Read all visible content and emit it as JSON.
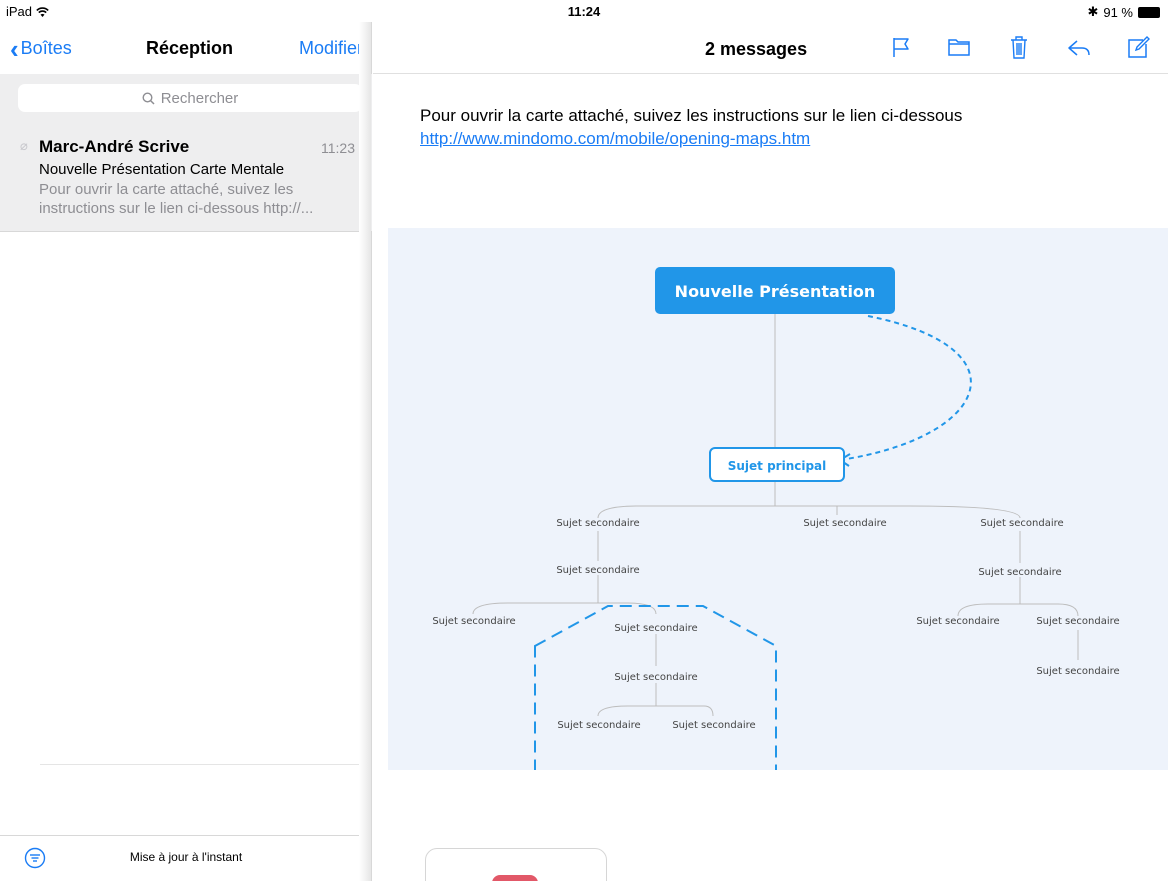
{
  "status_bar": {
    "device": "iPad",
    "time": "11:24",
    "battery": "91 %"
  },
  "left_nav": {
    "back_label": "Boîtes",
    "title": "Réception",
    "edit_label": "Modifier"
  },
  "search": {
    "placeholder": "Rechercher"
  },
  "mail_list": [
    {
      "sender": "Marc-André Scrive",
      "time": "11:23",
      "subject": "Nouvelle Présentation Carte Mentale",
      "preview_line1": "Pour ouvrir la carte attaché, suivez les",
      "preview_line2": "instructions sur le lien ci-dessous http://..."
    }
  ],
  "left_footer": {
    "status": "Mise à jour à l'instant"
  },
  "right_nav": {
    "message_count": "2 messages"
  },
  "toolbar_icons": [
    "flag-icon",
    "folder-icon",
    "trash-icon",
    "reply-icon",
    "compose-icon"
  ],
  "message": {
    "body": "Pour ouvrir la carte attaché, suivez les instructions sur le lien ci-dessous",
    "link": "http://www.mindomo.com/mobile/opening-maps.htm"
  },
  "mind_map": {
    "root": "Nouvelle Présentation",
    "main_topic": "Sujet principal",
    "secondary_label": "Sujet secondaire"
  },
  "colors": {
    "accent": "#1a7cf5",
    "map_blue": "#2196e8",
    "map_bg": "#eef3fb"
  }
}
